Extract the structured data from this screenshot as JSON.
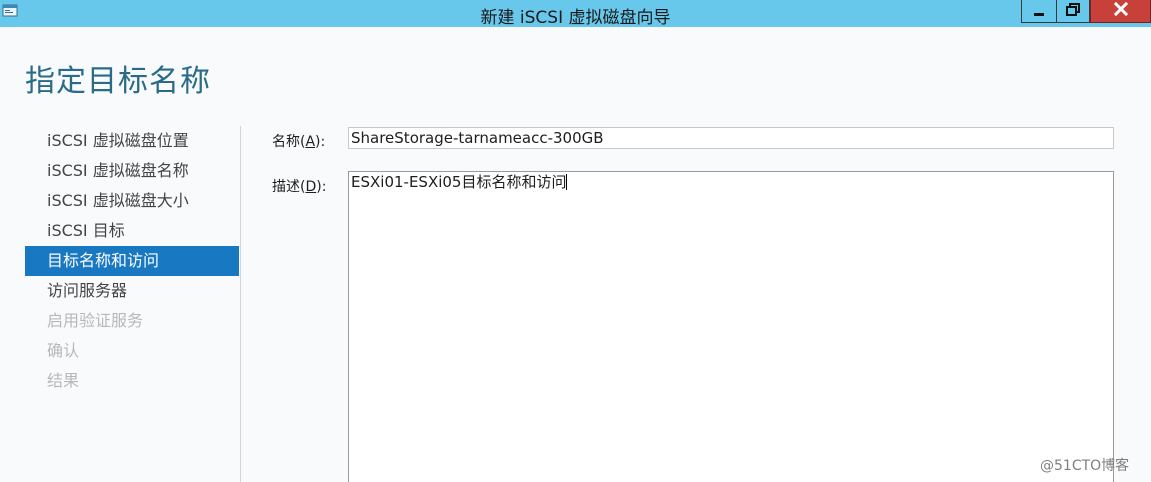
{
  "window": {
    "title": "新建 iSCSI 虚拟磁盘向导",
    "icon": "wizard-window-icon",
    "controls": {
      "minimize_icon": "minimize-icon",
      "maximize_icon": "restore-icon",
      "close_icon": "close-icon"
    },
    "colors": {
      "titlebar": "#67c8eb",
      "close_button": "#c8403a",
      "nav_active": "#1978c2",
      "heading": "#2a6b8a"
    }
  },
  "page": {
    "title": "指定目标名称"
  },
  "nav": {
    "items": [
      {
        "label": "iSCSI 虚拟磁盘位置",
        "state": "normal"
      },
      {
        "label": "iSCSI 虚拟磁盘名称",
        "state": "normal"
      },
      {
        "label": "iSCSI 虚拟磁盘大小",
        "state": "normal"
      },
      {
        "label": "iSCSI 目标",
        "state": "normal"
      },
      {
        "label": "目标名称和访问",
        "state": "active"
      },
      {
        "label": "访问服务器",
        "state": "normal"
      },
      {
        "label": "启用验证服务",
        "state": "disabled"
      },
      {
        "label": "确认",
        "state": "disabled"
      },
      {
        "label": "结果",
        "state": "disabled"
      }
    ]
  },
  "form": {
    "name": {
      "label_prefix": "名称(",
      "label_key": "A",
      "label_suffix": "):",
      "value": "ShareStorage-tarnameacc-300GB"
    },
    "description": {
      "label_prefix": "描述(",
      "label_key": "D",
      "label_suffix": "):",
      "value": "ESXi01-ESXi05目标名称和访问"
    }
  },
  "watermark": "@51CTO博客"
}
